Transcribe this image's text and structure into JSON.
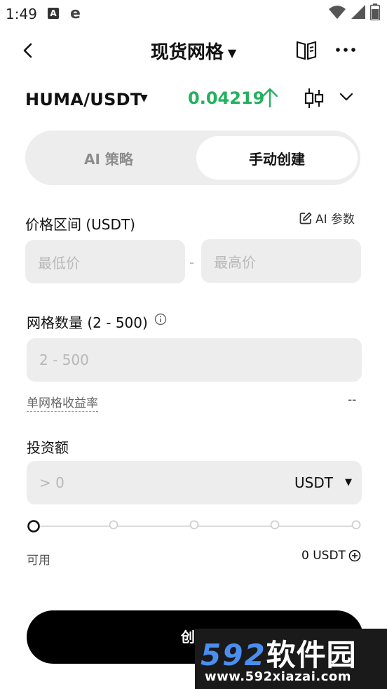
{
  "status": {
    "time": "1:49",
    "a_badge": "A",
    "e_glyph": "e"
  },
  "nav": {
    "title": "现货网格",
    "title_caret": "▼"
  },
  "pair": {
    "name": "HUMA/USDT",
    "caret": "▼",
    "price": "0.04219",
    "price_color": "#22b15e"
  },
  "tabs": [
    {
      "label": "AI 策略"
    },
    {
      "label": "手动创建"
    }
  ],
  "price_range": {
    "label": "价格区间 (USDT)",
    "ai_params": "AI 参数",
    "min_placeholder": "最低价",
    "max_placeholder": "最高价",
    "separator": "-"
  },
  "grid_count": {
    "label": "网格数量 (2 - 500)",
    "placeholder": "2 - 500",
    "yield_label": "单网格收益率",
    "yield_value": "--"
  },
  "investment": {
    "label": "投资额",
    "placeholder": "> 0",
    "unit": "USDT",
    "unit_caret": "▼",
    "slider_percent": 0
  },
  "available": {
    "label": "可用",
    "value": "0 USDT"
  },
  "create_button": "创建",
  "watermark": {
    "number": "592",
    "cn": "软件园",
    "url": "www.592xiazai.com"
  },
  "icons": [
    "back-icon",
    "book-icon",
    "more-icon",
    "arrow-up-icon",
    "candlestick-icon",
    "chevron-down-icon",
    "edit-icon",
    "info-icon",
    "plus-circle-icon",
    "wifi-icon",
    "signal-icon",
    "battery-icon"
  ]
}
